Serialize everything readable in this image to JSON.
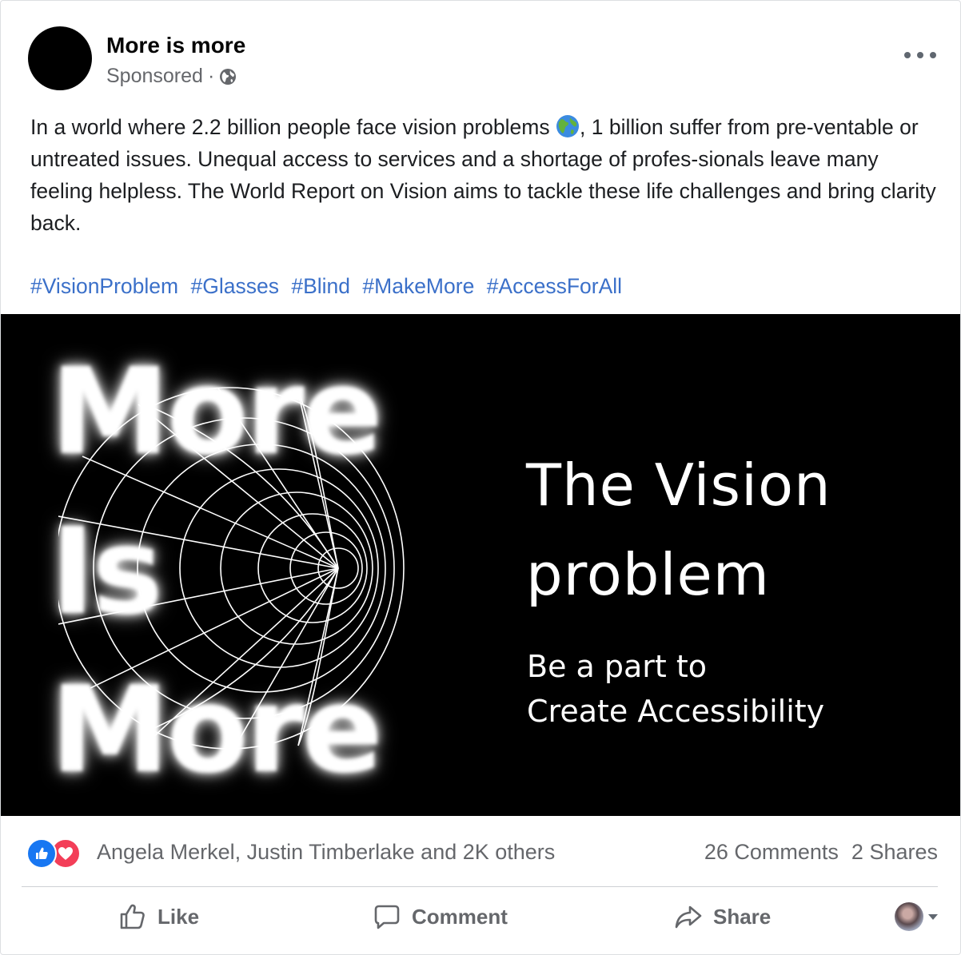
{
  "post": {
    "page_name": "More is more",
    "sponsored_label": "Sponsored",
    "separator": "·",
    "body": "In a world where 2.2 billion people face vision problems",
    "body_cont": ", 1 billion suffer from pre-ventable or untreated issues. Unequal access to services and a shortage of profes-sionals leave many feeling helpless. The World Report on Vision aims to tackle these life challenges and bring clarity back.",
    "hashtags": [
      "#VisionProblem",
      "#Glasses",
      "#Blind",
      "#MakeMore",
      "#AccessForAll"
    ]
  },
  "media": {
    "left_words": [
      "More",
      "Is",
      "More"
    ],
    "title_line1": "The Vision",
    "title_line2": "problem",
    "subtitle_line1": "Be a part to",
    "subtitle_line2": "Create Accessibility"
  },
  "stats": {
    "reaction_names": "Angela Merkel, Justin Timberlake and 2K others",
    "comments": "26 Comments",
    "shares": "2 Shares"
  },
  "actions": {
    "like": "Like",
    "comment": "Comment",
    "share": "Share"
  },
  "colors": {
    "hashtag": "#3b70c9",
    "like_reaction": "#1877f2",
    "love_reaction": "#f33e58",
    "secondary_text": "#65676b"
  }
}
